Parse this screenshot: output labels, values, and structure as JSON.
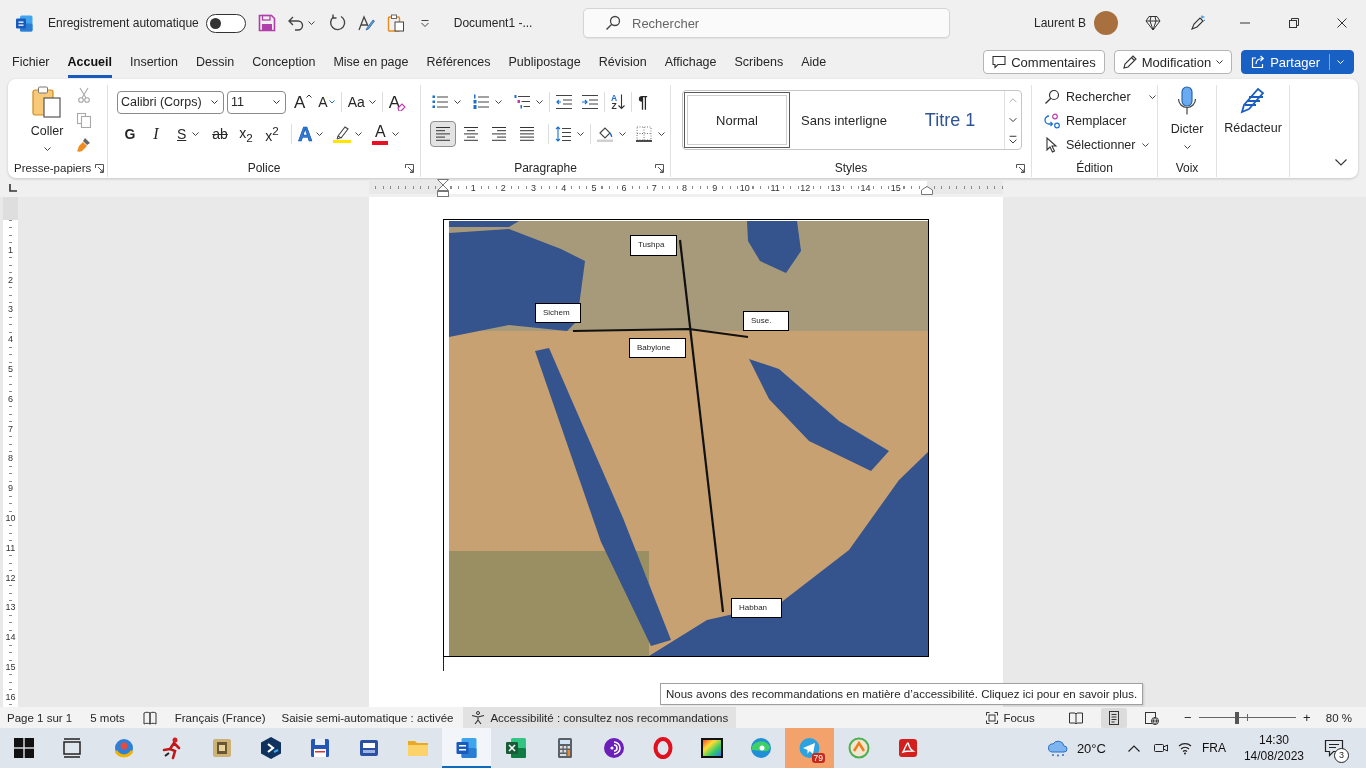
{
  "title_bar": {
    "autosave_label": "Enregistrement automatique",
    "autosave_on": false,
    "document_title": "Document1 -...",
    "search": {
      "placeholder": "Rechercher"
    },
    "user_name": "Laurent B"
  },
  "menu_tabs": [
    {
      "label": "Fichier",
      "selected": false
    },
    {
      "label": "Accueil",
      "selected": true
    },
    {
      "label": "Insertion",
      "selected": false
    },
    {
      "label": "Dessin",
      "selected": false
    },
    {
      "label": "Conception",
      "selected": false
    },
    {
      "label": "Mise en page",
      "selected": false
    },
    {
      "label": "Références",
      "selected": false
    },
    {
      "label": "Publipostage",
      "selected": false
    },
    {
      "label": "Révision",
      "selected": false
    },
    {
      "label": "Affichage",
      "selected": false
    },
    {
      "label": "Scribens",
      "selected": false
    },
    {
      "label": "Aide",
      "selected": false
    }
  ],
  "header_buttons": {
    "comments": "Commentaires",
    "mode": "Modification",
    "share": "Partager"
  },
  "ribbon": {
    "clipboard": {
      "label": "Presse-papiers",
      "paste": "Coller",
      "tools": [
        {
          "kind": "cut",
          "disabled": true
        },
        {
          "kind": "copy",
          "disabled": true
        },
        {
          "kind": "painter",
          "disabled": false
        }
      ]
    },
    "font": {
      "label": "Police",
      "name": "Calibri (Corps)",
      "size": "11",
      "grow": "A",
      "shrink": "A",
      "change_case": "Aa",
      "clear": "A",
      "styles": [
        {
          "kind": "bold",
          "label": "G",
          "dropdown": false
        },
        {
          "kind": "italic",
          "label": "I",
          "dropdown": false
        },
        {
          "kind": "underline",
          "label": "S",
          "dropdown": true
        },
        {
          "kind": "strike",
          "label": "ab",
          "dropdown": false
        },
        {
          "kind": "subscript",
          "label": "x$_{2}$",
          "dropdown": false
        },
        {
          "kind": "superscript",
          "label": "x$^{2}$",
          "dropdown": false
        }
      ],
      "effects_label": "A",
      "font_color_label": "A"
    },
    "paragraph": {
      "label": "Paragraphe",
      "sort": [
        "A",
        "Z"
      ],
      "marks": "¶",
      "alignments": [
        {
          "kind": "left",
          "selected": true
        },
        {
          "kind": "center",
          "selected": false
        },
        {
          "kind": "right",
          "selected": false
        },
        {
          "kind": "justify",
          "selected": false
        }
      ]
    },
    "styles": {
      "label": "Styles",
      "items": [
        {
          "label": "Normal",
          "kind": "body",
          "selected": true
        },
        {
          "label": "Sans interligne",
          "kind": "body",
          "selected": false
        },
        {
          "label": "Titre 1",
          "kind": "heading",
          "selected": false
        }
      ]
    },
    "editing": {
      "label": "Édition",
      "find": "Rechercher",
      "replace": "Remplacer",
      "select": "Sélectionner"
    },
    "voice": {
      "label": "Voix",
      "dictate": "Dicter"
    },
    "editor": {
      "button": "Rédacteur"
    }
  },
  "rulers": {
    "horizontal": [
      "1",
      "2",
      "3",
      "4",
      "5",
      "6",
      "7",
      "8",
      "9",
      "10",
      "11",
      "12",
      "13",
      "14",
      "15"
    ],
    "vertical": [
      "1",
      "2",
      "3",
      "4",
      "5",
      "6",
      "7",
      "8",
      "9",
      "10",
      "11",
      "12",
      "13",
      "14",
      "15",
      "16"
    ]
  },
  "document": {
    "text_boxes": [
      "Tushpa",
      "Sichem",
      "Suse.",
      "Babylone",
      "Habban"
    ]
  },
  "tooltip": "Nous avons des recommandations en matière d’accessibilité. Cliquez ici pour en savoir plus.",
  "status_bar": {
    "page": "Page 1 sur 1",
    "words": "5 mots",
    "language": "Français (France)",
    "autocomplete": "Saisie semi-automatique : activée",
    "accessibility": {
      "label": "Accessibilité : consultez nos recommandations",
      "highlighted": true
    },
    "focus": "Focus",
    "views": [
      {
        "kind": "read",
        "selected": false
      },
      {
        "kind": "print",
        "selected": true
      },
      {
        "kind": "web",
        "selected": false
      }
    ],
    "zoom": {
      "minus": "−",
      "plus": "+",
      "level": 0.39,
      "reading": "80 %"
    }
  },
  "taskbar": {
    "apps": [
      {
        "kind": "start",
        "selected": false,
        "highlighted": false
      },
      {
        "kind": "taskview",
        "selected": false,
        "highlighted": false
      },
      {
        "kind": "globe",
        "selected": false,
        "highlighted": false
      },
      {
        "kind": "figure",
        "selected": false,
        "highlighted": false
      },
      {
        "kind": "emblem",
        "selected": false,
        "highlighted": false
      },
      {
        "kind": "hexagon",
        "selected": false,
        "highlighted": false
      },
      {
        "kind": "floppy",
        "selected": false,
        "highlighted": false
      },
      {
        "kind": "printer",
        "selected": false,
        "highlighted": false
      },
      {
        "kind": "folder",
        "selected": false,
        "highlighted": false
      },
      {
        "kind": "document",
        "selected": true,
        "highlighted": false
      },
      {
        "kind": "spreadsheet",
        "selected": false,
        "highlighted": false
      },
      {
        "kind": "calculator",
        "selected": false,
        "highlighted": false
      },
      {
        "kind": "audio",
        "selected": false,
        "highlighted": false
      },
      {
        "kind": "ring",
        "selected": false,
        "highlighted": false
      },
      {
        "kind": "film",
        "selected": false,
        "highlighted": false
      },
      {
        "kind": "browser",
        "selected": false,
        "highlighted": false
      },
      {
        "kind": "messenger",
        "selected": false,
        "highlighted": true,
        "badge": "79"
      },
      {
        "kind": "circle",
        "selected": false,
        "highlighted": false
      },
      {
        "kind": "pdf",
        "selected": false,
        "highlighted": false
      }
    ],
    "weather": "20°C",
    "language": "FRA",
    "time": "14:30",
    "date": "14/08/2023",
    "notifications": "3"
  }
}
